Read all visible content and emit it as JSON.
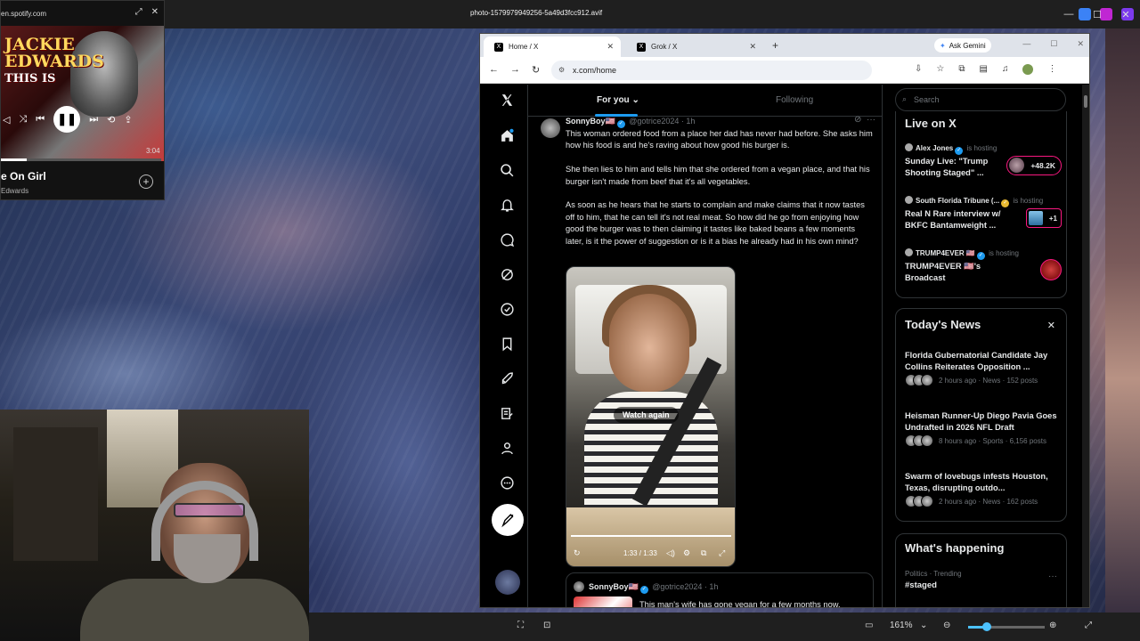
{
  "viewer": {
    "filename": "photo-1579979949256-5a49d3fcc912.avif",
    "zoom_level": "161%",
    "window_buttons": [
      "—",
      "☐",
      "✕"
    ]
  },
  "spotify": {
    "domain": "en.spotify.com",
    "art_title_line1": "JACKIE",
    "art_title_line2": "EDWARDS",
    "art_title_line3": "THIS IS",
    "duration": "3:04",
    "progress": 0.16,
    "song_title": "e On Girl",
    "artist": "Edwards"
  },
  "browser": {
    "tabs": [
      {
        "label": "Home / X",
        "active": true
      },
      {
        "label": "Grok / X",
        "active": false
      }
    ],
    "gemini_label": "Ask Gemini",
    "url": "x.com/home"
  },
  "x": {
    "feed_tabs": [
      "For you",
      "Following"
    ],
    "post": {
      "name": "SonnyBoy🇺🇸",
      "handle": "@gotrice2024 · 1h",
      "paragraphs": [
        "This woman ordered food from a place her dad has never had before. She asks him how his food is and he's raving about how good his burger is.",
        "She then lies to him and tells him that she ordered from a vegan place, and that his burger isn't made from beef that it's all vegetables.",
        "As soon as he hears that he starts to complain and make claims that it now tastes off to him, that he can tell it's not real meat. So how did he go from enjoying how good the burger was to then claiming it tastes like baked beans a few moments later, is it the power of suggestion or is it a bias he already had in his own mind?"
      ],
      "video_overlay": "Watch again",
      "video_time": "1:33 / 1:33"
    },
    "quote": {
      "name": "SonnyBoy🇺🇸",
      "handle": "@gotrice2024 · 1h",
      "text": "This man's wife has gone vegan for a few months now."
    },
    "search_placeholder": "Search",
    "live": {
      "title": "Live on X",
      "items": [
        {
          "host": "Alex Jones",
          "status": "is hosting",
          "title": "Sunday Live: \"Trump Shooting Staged\" ...",
          "badge": "+48.2K"
        },
        {
          "host": "South Florida Tribune (...",
          "status": "is hosting",
          "title": "Real N Rare interview w/ BKFC Bantamweight ...",
          "badge": "+1"
        },
        {
          "host": "TRUMP4EVER 🇺🇸",
          "status": "is hosting",
          "title": "TRUMP4EVER 🇺🇸's Broadcast",
          "badge": ""
        }
      ]
    },
    "news": {
      "title": "Today's News",
      "items": [
        {
          "title": "Florida Gubernatorial Candidate Jay Collins Reiterates Opposition ...",
          "meta": "2 hours ago · News · 152 posts"
        },
        {
          "title": "Heisman Runner-Up Diego Pavia Goes Undrafted in 2026 NFL Draft",
          "meta": "8 hours ago · Sports · 6,156 posts"
        },
        {
          "title": "Swarm of lovebugs infests Houston, Texas, disrupting outdo...",
          "meta": "2 hours ago · News · 162 posts"
        }
      ]
    },
    "happening": {
      "title": "What's happening",
      "category": "Politics · Trending",
      "name": "#staged"
    }
  }
}
